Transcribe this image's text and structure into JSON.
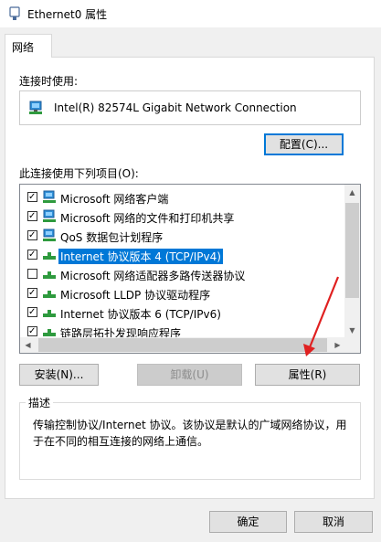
{
  "window": {
    "title": "Ethernet0 属性"
  },
  "tabs": [
    {
      "label": "网络"
    }
  ],
  "connect_using": {
    "label": "连接时使用:",
    "adapter": "Intel(R) 82574L Gigabit Network Connection",
    "configure_button": "配置(C)..."
  },
  "items_section": {
    "label": "此连接使用下列项目(O):",
    "items": [
      {
        "label": "Microsoft 网络客户端",
        "checked": true,
        "icon": "network-client-icon"
      },
      {
        "label": "Microsoft 网络的文件和打印机共享",
        "checked": true,
        "icon": "file-printer-sharing-icon"
      },
      {
        "label": "QoS 数据包计划程序",
        "checked": true,
        "icon": "qos-icon"
      },
      {
        "label": "Internet 协议版本 4 (TCP/IPv4)",
        "checked": true,
        "icon": "protocol-icon",
        "selected": true
      },
      {
        "label": "Microsoft 网络适配器多路传送器协议",
        "checked": false,
        "icon": "protocol-icon"
      },
      {
        "label": "Microsoft LLDP 协议驱动程序",
        "checked": true,
        "icon": "protocol-icon"
      },
      {
        "label": "Internet 协议版本 6 (TCP/IPv6)",
        "checked": true,
        "icon": "protocol-icon"
      },
      {
        "label": "链路层拓扑发现响应程序",
        "checked": true,
        "icon": "protocol-icon"
      }
    ]
  },
  "buttons": {
    "install": "安装(N)...",
    "uninstall": "卸载(U)",
    "properties": "属性(R)",
    "ok": "确定",
    "cancel": "取消"
  },
  "description": {
    "title": "描述",
    "text": "传输控制协议/Internet 协议。该协议是默认的广域网络协议，用于在不同的相互连接的网络上通信。"
  },
  "colors": {
    "accent": "#0078d7",
    "annotation_arrow": "#e02020"
  }
}
